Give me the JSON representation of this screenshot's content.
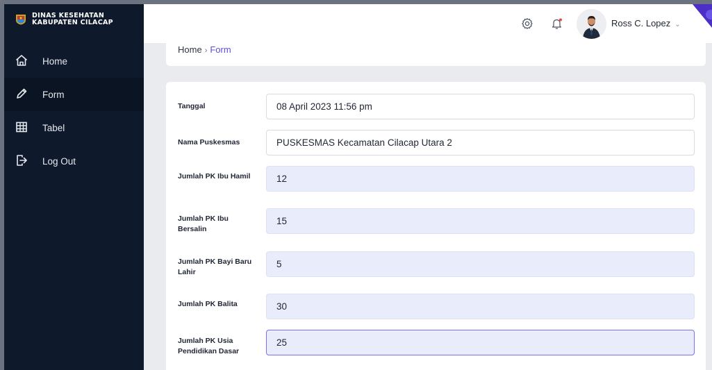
{
  "brand": {
    "line1": "DINAS KESEHATAN",
    "line2": "KABUPATEN CILACAP"
  },
  "sidebar": {
    "items": [
      {
        "label": "Home",
        "icon": "home-icon"
      },
      {
        "label": "Form",
        "icon": "pencil-icon"
      },
      {
        "label": "Tabel",
        "icon": "table-icon"
      },
      {
        "label": "Log Out",
        "icon": "logout-icon"
      }
    ],
    "active_index": 1
  },
  "header": {
    "user_name": "Ross C. Lopez",
    "icons": [
      "settings-icon",
      "bell-icon",
      "chevron-down-icon"
    ]
  },
  "breadcrumb": {
    "home": "Home",
    "separator": "›",
    "current": "Form"
  },
  "form": {
    "fields": [
      {
        "label": "Tanggal",
        "value": "08 April 2023 11:56 pm"
      },
      {
        "label": "Nama Puskesmas",
        "value": "PUSKESMAS Kecamatan Cilacap Utara 2"
      },
      {
        "label": "Jumlah PK Ibu Hamil",
        "value": "12"
      },
      {
        "label": "Jumlah PK Ibu Bersalin",
        "value": "15"
      },
      {
        "label": "Jumlah PK Bayi Baru Lahir",
        "value": "5"
      },
      {
        "label": "Jumlah PK Balita",
        "value": "30"
      },
      {
        "label": "Jumlah PK Usia Pendidikan Dasar",
        "value": "25"
      }
    ]
  },
  "colors": {
    "sidebar_bg": "#0e1a2b",
    "accent": "#5b4dde",
    "filled_input_bg": "#e8ecfb"
  }
}
